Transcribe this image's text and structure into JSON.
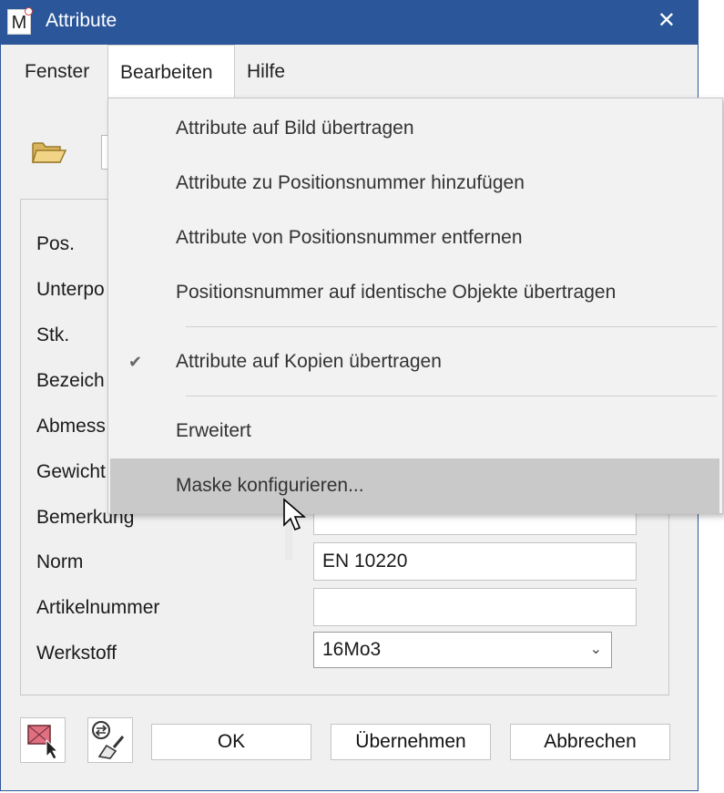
{
  "window": {
    "title": "Attribute",
    "app_icon_letter": "M",
    "close_symbol": "✕"
  },
  "menubar": {
    "items": [
      {
        "label": "Fenster"
      },
      {
        "label": "Bearbeiten",
        "open": true
      },
      {
        "label": "Hilfe"
      }
    ]
  },
  "dropdown": {
    "items": [
      {
        "label": "Attribute auf Bild übertragen"
      },
      {
        "label": "Attribute zu Positionsnummer hinzufügen"
      },
      {
        "label": "Attribute von Positionsnummer entfernen"
      },
      {
        "label": "Positionsnummer auf identische Objekte übertragen"
      },
      {
        "label": "Attribute auf Kopien übertragen",
        "checked": true
      },
      {
        "label": "Erweitert"
      },
      {
        "label": "Maske konfigurieren...",
        "highlighted": true
      }
    ],
    "check_symbol": "✔"
  },
  "form": {
    "labels": [
      "Pos.",
      "Unterpo",
      "Stk.",
      "Bezeich",
      "Abmess",
      "Gewicht",
      "Bemerkung",
      "Norm",
      "Artikelnummer",
      "Werkstoff"
    ],
    "bemerkung_value": "",
    "norm_value": "EN 10220",
    "artikelnummer_value": "",
    "werkstoff_value": "16Mo3"
  },
  "buttons": {
    "ok": "OK",
    "apply": "Übernehmen",
    "cancel": "Abbrechen"
  },
  "icons": {
    "folder": "folder-open-icon",
    "pick": "pick-attributes-icon",
    "clean": "transfer-brush-icon"
  },
  "colors": {
    "titlebar": "#2b579a",
    "menu_highlight": "#c9c9c9"
  }
}
